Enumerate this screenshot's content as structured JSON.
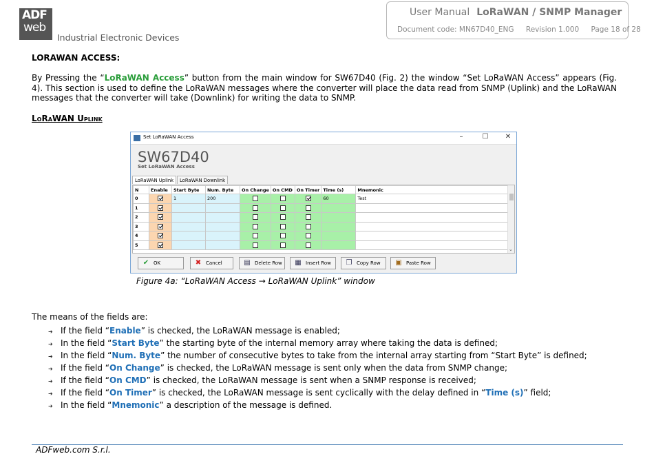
{
  "header": {
    "logo_top": "ADF",
    "logo_bottom": "web",
    "company": "Industrial Electronic Devices",
    "doc_type": "User Manual",
    "product": "LoRaWAN / SNMP Manager",
    "doc_code": "Document code: MN67D40_ENG",
    "revision": "Revision 1.000",
    "page": "Page 18 of 28"
  },
  "section": {
    "heading": "LORAWAN ACCESS:",
    "para_1": "By Pressing the “",
    "para_link": "LoRaWAN Access",
    "para_2": "” button from the main window for SW67D40 (Fig. 2) the window “Set LoRaWAN Access” appears (Fig. 4). This section is used to define the LoRaWAN messages where the converter will place the data read from SNMP (Uplink) and the LoRaWAN messages that the converter will take (Downlink) for writing the data to SNMP.",
    "subheading": "LoRaWAN Uplink"
  },
  "window": {
    "title": "Set LoRaWAN Access",
    "controls": [
      "–",
      "☐",
      "✕"
    ],
    "app_name": "SW67D40",
    "subtitle": "Set LoRaWAN Access",
    "tabs": [
      "LoRaWAN Uplink",
      "LoRaWAN Downlink"
    ],
    "columns": [
      "N",
      "Enable",
      "Start Byte",
      "Num. Byte",
      "On Change",
      "On CMD",
      "On Timer",
      "Time (s)",
      "Mnemonic"
    ],
    "rows": [
      {
        "n": "0",
        "enable": true,
        "start": "1",
        "num": "200",
        "change": false,
        "cmd": false,
        "timer": true,
        "time": "60",
        "mnemonic": "Test"
      },
      {
        "n": "1",
        "enable": true,
        "start": "",
        "num": "",
        "change": false,
        "cmd": false,
        "timer": false,
        "time": "",
        "mnemonic": ""
      },
      {
        "n": "2",
        "enable": true,
        "start": "",
        "num": "",
        "change": false,
        "cmd": false,
        "timer": false,
        "time": "",
        "mnemonic": ""
      },
      {
        "n": "3",
        "enable": true,
        "start": "",
        "num": "",
        "change": false,
        "cmd": false,
        "timer": false,
        "time": "",
        "mnemonic": ""
      },
      {
        "n": "4",
        "enable": true,
        "start": "",
        "num": "",
        "change": false,
        "cmd": false,
        "timer": false,
        "time": "",
        "mnemonic": ""
      },
      {
        "n": "5",
        "enable": true,
        "start": "",
        "num": "",
        "change": false,
        "cmd": false,
        "timer": false,
        "time": "",
        "mnemonic": ""
      }
    ],
    "buttons": [
      {
        "label": "OK",
        "icon": "check-icon"
      },
      {
        "label": "Cancel",
        "icon": "cancel-icon"
      },
      {
        "label": "Delete Row",
        "icon": "delete-row-icon"
      },
      {
        "label": "Insert Row",
        "icon": "insert-row-icon"
      },
      {
        "label": "Copy Row",
        "icon": "copy-icon"
      },
      {
        "label": "Paste Row",
        "icon": "paste-icon"
      }
    ]
  },
  "caption": "Figure 4a: “LoRaWAN Access → LoRaWAN Uplink” window",
  "means_intro": "The means of the fields are:",
  "fields": [
    {
      "pre": "If the field “",
      "term": "Enable",
      "post": "” is checked, the LoRaWAN message is enabled;"
    },
    {
      "pre": "In the field “",
      "term": "Start Byte",
      "post": "” the starting byte of the internal memory array where taking the data is defined;"
    },
    {
      "pre": "In the field “",
      "term": "Num. Byte",
      "post": "” the number of consecutive bytes to take from the internal array starting from “Start Byte” is defined;"
    },
    {
      "pre": "If the field “",
      "term": "On Change",
      "post": "” is checked, the LoRaWAN message is sent only when the data from SNMP change;"
    },
    {
      "pre": "If the field “",
      "term": "On CMD",
      "post": "” is checked, the LoRaWAN message is sent when a SNMP response is received;"
    },
    {
      "pre": "If the field “",
      "term": "On Timer",
      "post": "” is checked, the LoRaWAN message is sent cyclically with the delay defined in “",
      "term2": "Time (s)",
      "post2": "” field;"
    },
    {
      "pre": "In the field “",
      "term": "Mnemonic",
      "post": "” a description of the message is defined."
    }
  ],
  "footer": "ADFweb.com S.r.l."
}
